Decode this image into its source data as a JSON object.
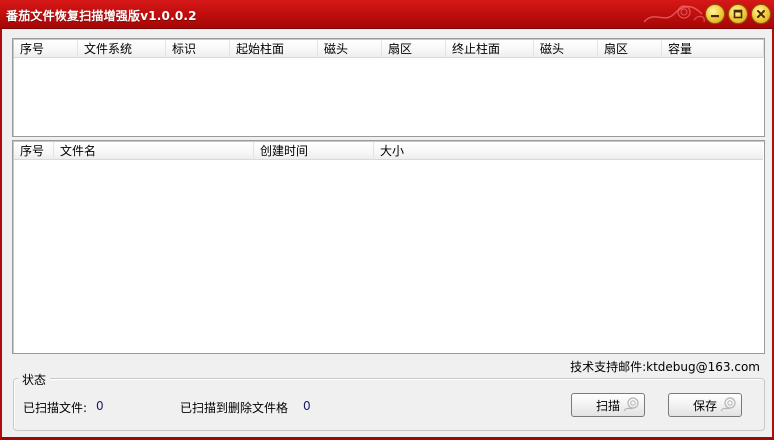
{
  "window": {
    "title": "番茄文件恢复扫描增强版v1.0.0.2",
    "accent_color": "#c41010",
    "buttons": [
      "minimize-icon",
      "maximize-icon",
      "close-icon"
    ]
  },
  "partition_table": {
    "columns": [
      "序号",
      "文件系统",
      "标识",
      "起始柱面",
      "磁头",
      "扇区",
      "终止柱面",
      "磁头",
      "扇区",
      "容量"
    ],
    "rows": []
  },
  "file_table": {
    "columns": [
      "序号",
      "文件名",
      "创建时间",
      "大小"
    ],
    "rows": []
  },
  "support_text": "技术支持邮件:ktdebug@163.com",
  "status": {
    "legend": "状态",
    "scanned_files_label": "已扫描文件:",
    "scanned_files_value": "0",
    "deleted_found_label": "已扫描到删除文件格",
    "deleted_found_value": "0"
  },
  "actions": {
    "scan_label": "扫描",
    "save_label": "保存"
  }
}
